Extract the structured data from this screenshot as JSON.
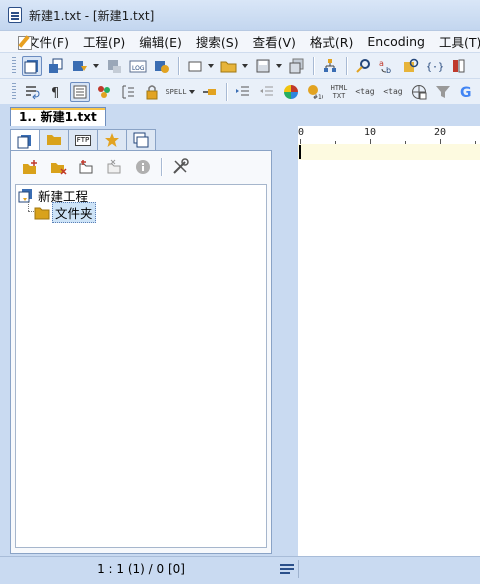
{
  "window": {
    "title": "新建1.txt - [新建1.txt]"
  },
  "menu": {
    "items": [
      "文件(F)",
      "工程(P)",
      "编辑(E)",
      "搜索(S)",
      "查看(V)",
      "格式(R)",
      "Encoding",
      "工具(T)"
    ]
  },
  "toolbar2": {
    "spell_label": "SPELL",
    "html_label": "HTML\nTXT",
    "tag_close_label": "<tag",
    "tag_open_label": "<tag"
  },
  "doc_tabs": [
    {
      "label": "1.. 新建1.txt",
      "active": true
    }
  ],
  "panel": {
    "ftp_tab_label": "FTP",
    "tree": {
      "root_label": "新建工程",
      "child_label": "文件夹"
    }
  },
  "ruler": {
    "labels": [
      "0",
      "10",
      "20"
    ]
  },
  "status": {
    "position": "1 : 1 (1) / 0   [0]"
  },
  "colors": {
    "frame_bg": "#c9daf1",
    "current_line": "#fdfae0",
    "selection": "#cde3f7",
    "folder": "#d9a21b"
  }
}
